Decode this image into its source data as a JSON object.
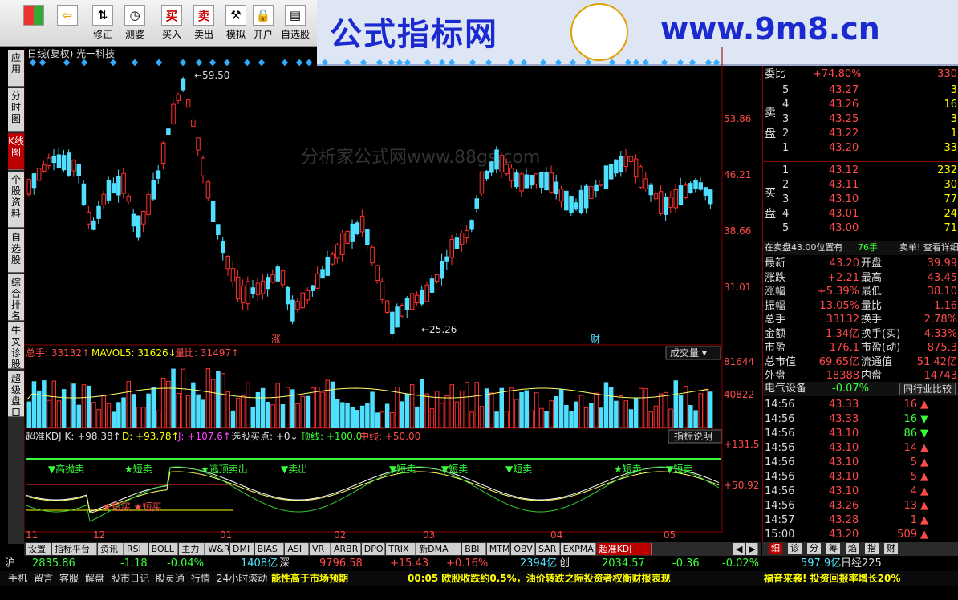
{
  "toolbar": {
    "buttons": [
      {
        "label": "修正",
        "icon": "up-down-arrow-icon",
        "glyph": "⇅"
      },
      {
        "label": "测婆",
        "icon": "clock-icon",
        "glyph": "◷"
      },
      {
        "label": "买入",
        "icon": "buy-icon",
        "glyph": "买"
      },
      {
        "label": "卖出",
        "icon": "sell-icon",
        "glyph": "卖"
      },
      {
        "label": "模拟",
        "icon": "hammer-icon",
        "glyph": "⚒"
      },
      {
        "label": "开户",
        "icon": "lock-icon",
        "glyph": "🔒"
      },
      {
        "label": "自选股",
        "icon": "folder-icon",
        "glyph": "▤"
      }
    ]
  },
  "banner": {
    "cn": "公式指标网",
    "url": "www.9m8.cn"
  },
  "left_tabs": [
    {
      "label": "应用",
      "active": false
    },
    {
      "label": "分时图",
      "active": false
    },
    {
      "label": "K线图",
      "active": true
    },
    {
      "label": "个股资料",
      "active": false
    },
    {
      "label": "自选股",
      "active": false
    },
    {
      "label": "综合排名",
      "active": false
    },
    {
      "label": "牛叉诊股",
      "active": false
    },
    {
      "label": "超级盘口",
      "active": false
    }
  ],
  "chart": {
    "title": "日线(复权) 光一科技",
    "watermark": "分析家公式网www.88gs.com",
    "price_labels": [
      "53.86",
      "46.21",
      "38.66",
      "31.01"
    ],
    "high_label": "←59.50",
    "low_label": "←25.26",
    "tag_zhang": "涨",
    "tag_cai": "财",
    "vol_header": {
      "a": "总手: 33132",
      "b": "MAVOL5: 31626",
      "c": "量比: 31497"
    },
    "vol_btn": "成交量",
    "vol_labels": [
      "81644",
      "40822"
    ],
    "kdj_header": {
      "a": "超准KDJ K: +98.38",
      "b": "D: +93.78",
      "c": "J: +107.6",
      "d": "选股买点: +0",
      "e": "顶线: +100.0",
      "f": "中线: +50.00"
    },
    "kdj_btn": "指标说明",
    "kdj_labels": [
      "+131.5",
      "+50.92"
    ],
    "kdj_texts": [
      "▼高抛卖",
      "★短卖",
      "★逃顶卖出",
      "▼卖出",
      "▼短卖",
      "▼短卖",
      "▼短卖",
      "★短卖",
      "▼短卖"
    ],
    "kdj_buy": "★短买 ★短买",
    "months": [
      "11",
      "12",
      "01",
      "02",
      "03",
      "04",
      "05"
    ]
  },
  "bottom_tabs": [
    "设置",
    "指标平台",
    "资讯",
    "RSI",
    "BOLL",
    "主力",
    "W&R",
    "DMI",
    "BIAS",
    "ASI",
    "VR",
    "ARBR",
    "DPO",
    "TRIX",
    "新DMA",
    "BBI",
    "MTM",
    "OBV",
    "SAR",
    "EXPMA",
    "超准KDJ"
  ],
  "right_tabs": [
    "细",
    "诊",
    "分",
    "筹",
    "焰",
    "指",
    "财"
  ],
  "panel": {
    "weibi": {
      "label": "委比",
      "value": "+74.80%",
      "vol": "330"
    },
    "sell_label": "卖盘",
    "buy_label": "买盘",
    "asks": [
      {
        "lv": "5",
        "p": "43.27",
        "v": "3"
      },
      {
        "lv": "4",
        "p": "43.26",
        "v": "16"
      },
      {
        "lv": "3",
        "p": "43.25",
        "v": "3"
      },
      {
        "lv": "2",
        "p": "43.22",
        "v": "1"
      },
      {
        "lv": "1",
        "p": "43.20",
        "v": "33"
      }
    ],
    "bids": [
      {
        "lv": "1",
        "p": "43.12",
        "v": "232"
      },
      {
        "lv": "2",
        "p": "43.11",
        "v": "30"
      },
      {
        "lv": "3",
        "p": "43.10",
        "v": "77"
      },
      {
        "lv": "4",
        "p": "43.01",
        "v": "24"
      },
      {
        "lv": "5",
        "p": "43.00",
        "v": "71"
      }
    ],
    "notice": {
      "a": "在卖盘43.00位置有",
      "b": "76手",
      "c": "卖单! 查看详细"
    },
    "stats": [
      [
        "最新",
        "43.20",
        "开盘",
        "39.99"
      ],
      [
        "涨跌",
        "+2.21",
        "最高",
        "43.45"
      ],
      [
        "涨幅",
        "+5.39%",
        "最低",
        "38.10"
      ],
      [
        "振幅",
        "13.05%",
        "量比",
        "1.16"
      ],
      [
        "总手",
        "33132",
        "换手",
        "2.78%"
      ],
      [
        "金额",
        "1.34亿",
        "换手(实)",
        "4.33%"
      ],
      [
        "市盈",
        "176.1",
        "市盈(动)",
        "875.3"
      ],
      [
        "总市值",
        "69.65亿",
        "流通值",
        "51.42亿"
      ],
      [
        "外盘",
        "18388",
        "内盘",
        "14743"
      ]
    ],
    "sector": {
      "name": "电气设备",
      "chg": "-0.07%",
      "btn": "同行业比较"
    },
    "ticks": [
      {
        "t": "14:56",
        "p": "43.33",
        "v": "16",
        "d": "up"
      },
      {
        "t": "14:56",
        "p": "43.33",
        "v": "16",
        "d": "dn"
      },
      {
        "t": "14:56",
        "p": "43.10",
        "v": "86",
        "d": "dn"
      },
      {
        "t": "14:56",
        "p": "43.10",
        "v": "14",
        "d": "up"
      },
      {
        "t": "14:56",
        "p": "43.10",
        "v": "5",
        "d": "up"
      },
      {
        "t": "14:56",
        "p": "43.10",
        "v": "5",
        "d": "up"
      },
      {
        "t": "14:56",
        "p": "43.10",
        "v": "4",
        "d": "up"
      },
      {
        "t": "14:56",
        "p": "43.26",
        "v": "13",
        "d": "up"
      },
      {
        "t": "14:57",
        "p": "43.28",
        "v": "1",
        "d": "up"
      },
      {
        "t": "15:00",
        "p": "43.20",
        "v": "509",
        "d": "up"
      }
    ]
  },
  "status1": {
    "sh": "沪",
    "a": "2835.86",
    "b": "-1.18",
    "c": "-0.04%",
    "d": "1408亿",
    "sz": "深",
    "e": "9796.58",
    "f": "+15.43",
    "g": "+0.16%",
    "h": "2394亿",
    "cy": "创",
    "i": "2034.57",
    "j": "-0.36",
    "k": "-0.02%",
    "l": "597.9亿",
    "m": "日经225"
  },
  "status2": {
    "items": [
      "手机",
      "留言",
      "客服",
      "解盘",
      "股市日记",
      "股灵通",
      "行情",
      "24小时滚动"
    ],
    "news1": "能性高于市场预期",
    "news2": "00:05 欧股收跌约0.5%，油价转跌之际投资者权衡财报表现",
    "news3": "福音来袭! 投资回报率增长20%"
  }
}
